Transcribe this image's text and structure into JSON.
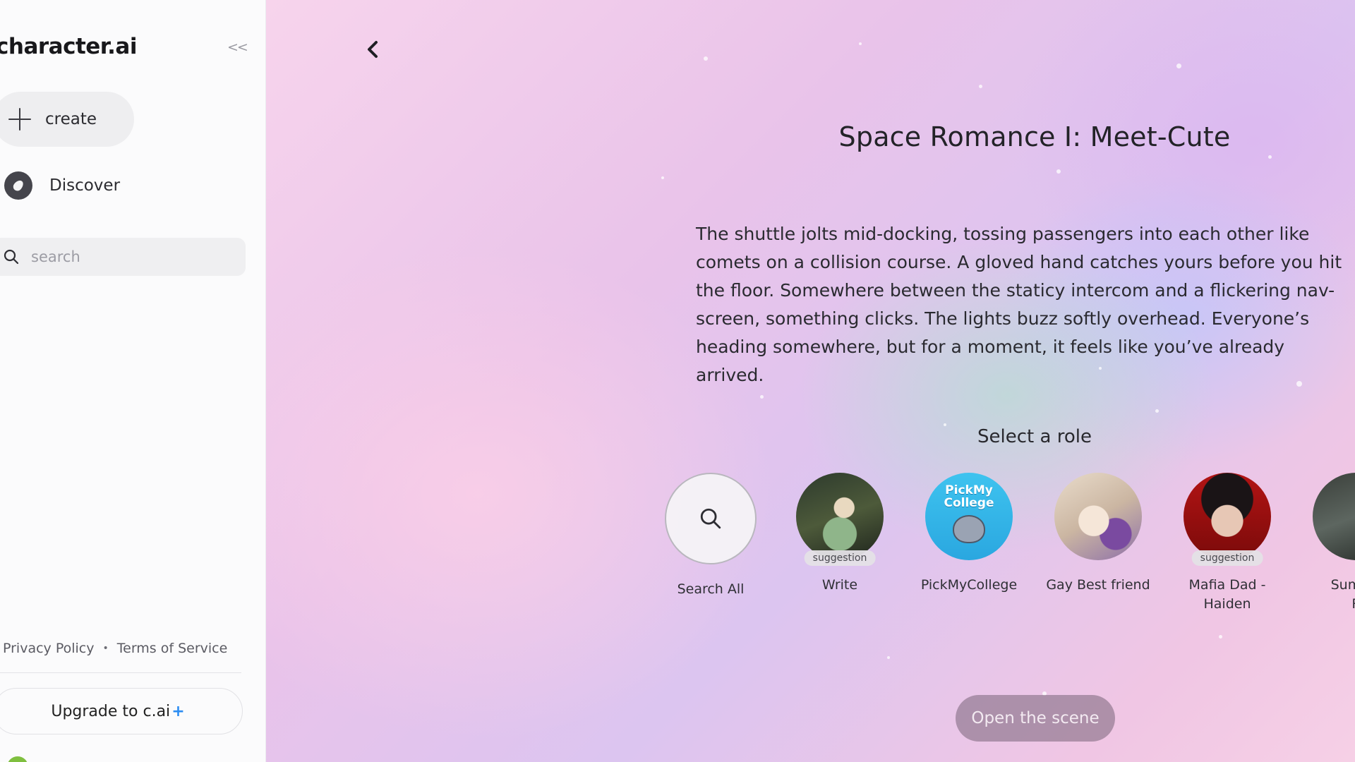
{
  "sidebar": {
    "brand": "character.ai",
    "collapse_label": "<<",
    "create_label": "create",
    "discover_label": "Discover",
    "search_placeholder": "search",
    "privacy_label": "Privacy Policy",
    "dot": "•",
    "terms_label": "Terms of Service",
    "upgrade_label": "Upgrade to c.ai",
    "upgrade_plus": "+"
  },
  "scene": {
    "title": "Space Romance I: Meet-Cute",
    "description": "The shuttle jolts mid-docking, tossing passengers into each other like comets on a collision course. A gloved hand catches yours before you hit the floor. Somewhere between the staticy intercom and a flickering nav-screen, something clicks. The lights buzz softly overhead. Everyone’s heading somewhere, but for a moment, it feels like you’ve already arrived.",
    "role_heading": "Select a role",
    "open_label": "Open the scene"
  },
  "roles": [
    {
      "name": "Search All",
      "icon": "search-icon"
    },
    {
      "name": "Write",
      "badge": "suggestion"
    },
    {
      "name": "PickMyCollege",
      "logo_text": "PickMy College"
    },
    {
      "name": "Gay Best friend"
    },
    {
      "name": "Mafia Dad -\nHaiden",
      "badge": "suggestion"
    },
    {
      "name": "Summe\nR"
    }
  ],
  "colors": {
    "accent_plus": "#2b8cf2",
    "open_button": "#78647899"
  }
}
